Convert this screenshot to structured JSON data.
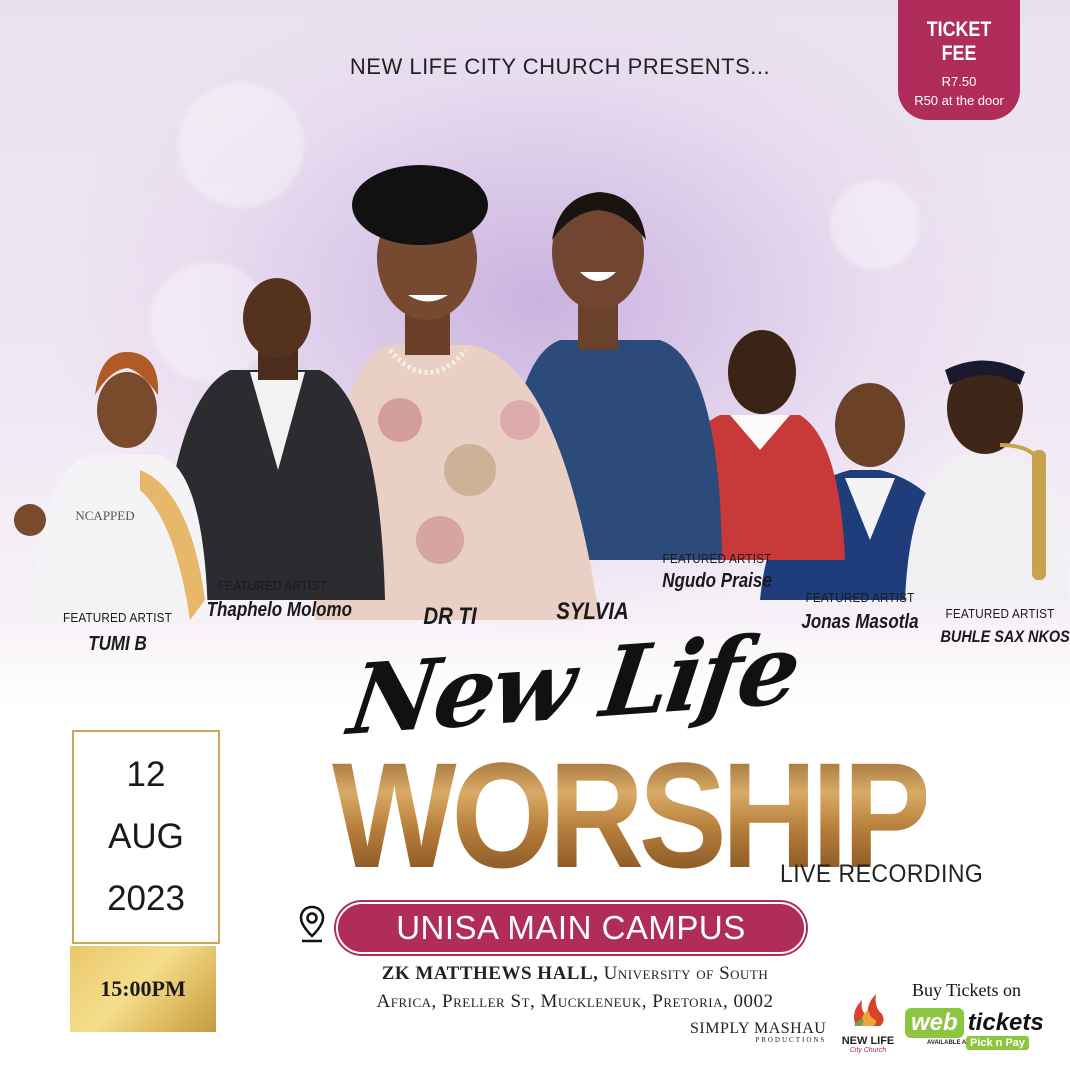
{
  "header": {
    "presents": "NEW LIFE CITY CHURCH PRESENTS..."
  },
  "ticket": {
    "title": "TICKET FEE",
    "price": "R7.50",
    "door": "R50 at the door"
  },
  "artists": [
    {
      "role": "FEATURED ARTIST",
      "name": "TUMI B"
    },
    {
      "role": "FEATURED ARTIST",
      "name": "Thaphelo Molomo"
    },
    {
      "role": "",
      "name": "DR TI"
    },
    {
      "role": "",
      "name": "SYLVIA"
    },
    {
      "role": "FEATURED ARTIST",
      "name": "Ngudo Praise"
    },
    {
      "role": "FEATURED ARTIST",
      "name": "Jonas Masotla"
    },
    {
      "role": "FEATURED ARTIST",
      "name": "BUHLE SAX NKOSI"
    }
  ],
  "shirt_text": "NCAPPED",
  "event": {
    "script_title": "New Life",
    "main_title": "WORSHIP",
    "subtitle": "LIVE RECORDING"
  },
  "venue": {
    "name": "UNISA MAIN CAMPUS",
    "hall": "ZK MATTHEWS HALL,",
    "address_1": " University of South",
    "address_2": "Africa, Preller St, Muckleneuk, Pretoria, 0002"
  },
  "date": {
    "day": "12",
    "month": "AUG",
    "year": "2023",
    "time": "15:00PM"
  },
  "footer": {
    "producer": "SIMPLY MASHAU",
    "producer_sub": "PRODUCTIONS",
    "church_logo": "NEW LIFE",
    "church_logo_sub": "City Church",
    "buy": "Buy Tickets on",
    "web": "web",
    "tickets": "tickets",
    "available_at": "AVAILABLE AT",
    "retailer": "Pick n Pay"
  },
  "colors": {
    "accent": "#b02c5a",
    "gold": "#b8843f",
    "date_gold": "#e9c76a",
    "webtickets_green": "#8cc63f"
  }
}
